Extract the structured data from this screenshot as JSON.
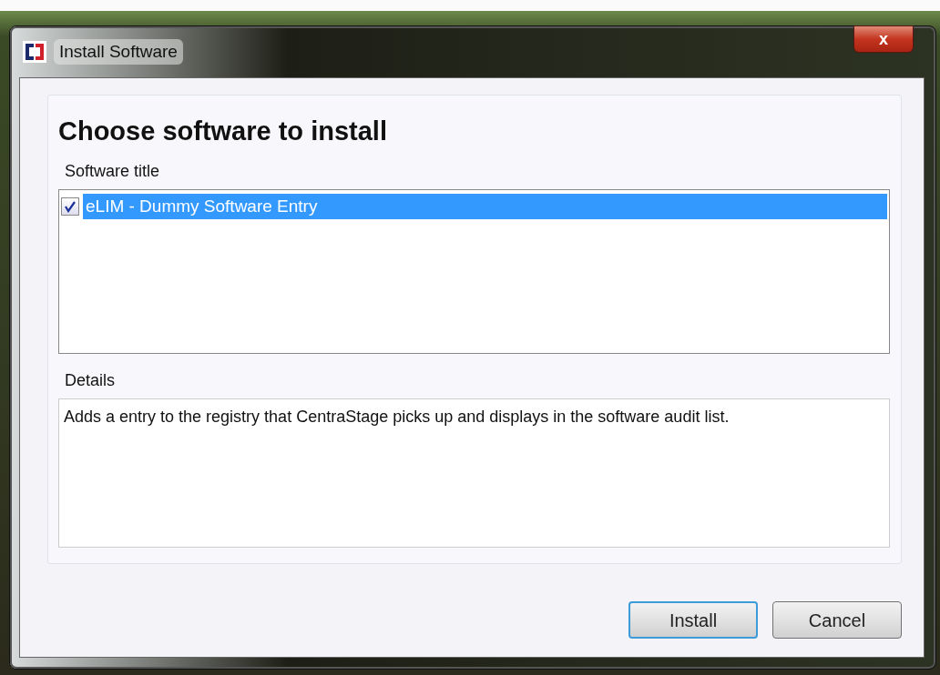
{
  "window": {
    "title": "Install Software",
    "close": "x"
  },
  "heading": "Choose software to install",
  "software_list": {
    "label": "Software title",
    "items": [
      {
        "name": "eLIM - Dummy Software Entry",
        "checked": true,
        "selected": true
      }
    ]
  },
  "details": {
    "label": "Details",
    "text": "Adds a entry to the registry that CentraStage picks up and displays in the software audit list."
  },
  "buttons": [
    {
      "label": "Install",
      "default": true
    },
    {
      "label": "Cancel",
      "default": false
    }
  ]
}
